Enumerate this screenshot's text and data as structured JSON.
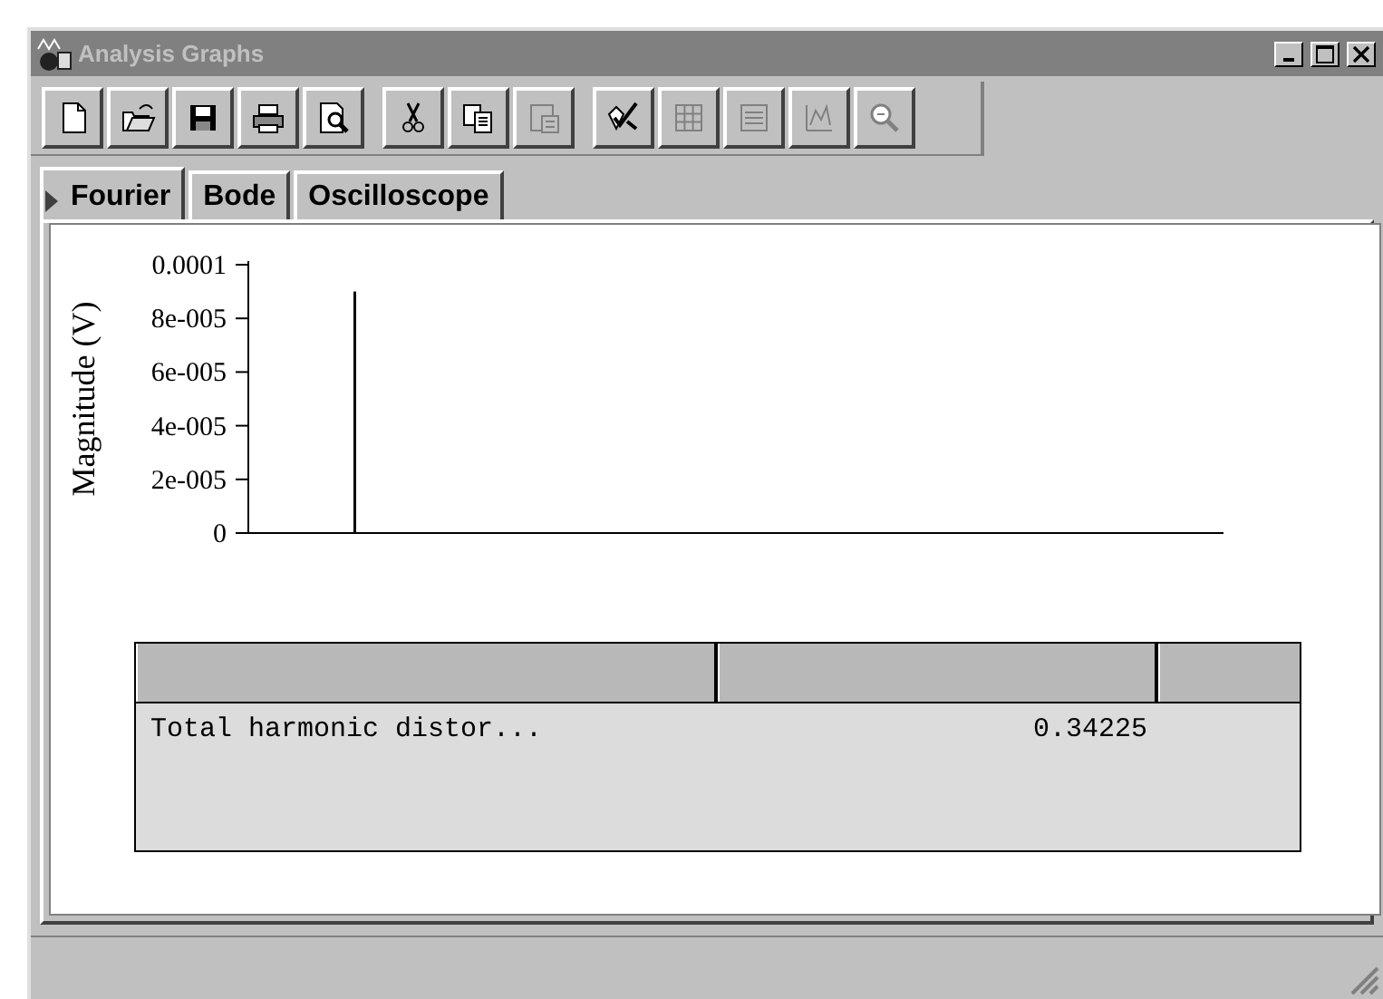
{
  "window": {
    "title": "Analysis Graphs",
    "active": false
  },
  "toolbar": [
    {
      "disabled": false
    },
    {
      "disabled": false
    },
    {
      "disabled": false
    },
    {
      "disabled": false
    },
    {
      "disabled": false
    },
    {
      "disabled": false
    },
    {
      "disabled": false
    },
    {
      "disabled": true
    },
    {
      "disabled": false
    },
    {
      "disabled": true
    },
    {
      "disabled": true
    },
    {
      "disabled": true
    },
    {
      "disabled": true
    }
  ],
  "tabs": [
    {
      "label": "Fourier",
      "selected": true
    },
    {
      "label": "Bode",
      "selected": false
    },
    {
      "label": "Oscilloscope",
      "selected": false
    }
  ],
  "chart_data": {
    "type": "bar",
    "ylabel": "Magnitude (V)",
    "ylim": [
      0,
      0.0001
    ],
    "yticks": [
      {
        "value": 0,
        "label": "0"
      },
      {
        "value": 2e-05,
        "label": "2e-005"
      },
      {
        "value": 4e-05,
        "label": "4e-005"
      },
      {
        "value": 6e-05,
        "label": "6e-005"
      },
      {
        "value": 8e-05,
        "label": "8e-005"
      },
      {
        "value": 0.0001,
        "label": "0.0001"
      }
    ],
    "values": [
      9e-05
    ]
  },
  "table": {
    "rows": [
      [
        "Total harmonic distor...",
        "0.34225"
      ]
    ]
  }
}
